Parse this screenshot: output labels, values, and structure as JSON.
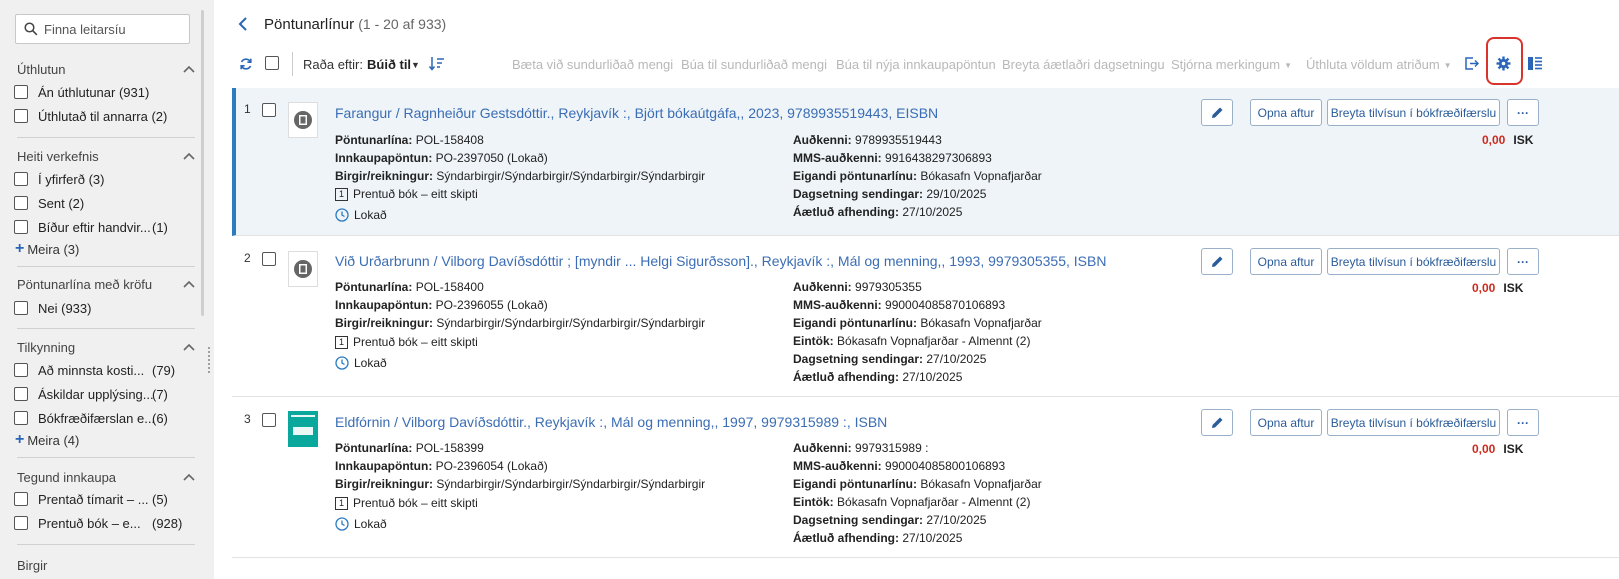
{
  "search": {
    "placeholder": "Finna leitarsíu"
  },
  "facets": [
    {
      "title": "Úthlutun",
      "items": [
        {
          "label": "Án úthlutunar (931)",
          "count": ""
        },
        {
          "label": "Úthlutað til annarra (2)",
          "count": ""
        }
      ]
    },
    {
      "title": "Heiti verkefnis",
      "items": [
        {
          "label": "Í yfirferð (3)",
          "count": ""
        },
        {
          "label": "Sent (2)",
          "count": ""
        },
        {
          "label": "Bíður eftir handvir...",
          "count": "(1)"
        }
      ],
      "more": "Meira (3)"
    },
    {
      "title": "Pöntunarlína með kröfu",
      "items": [
        {
          "label": "Nei (933)",
          "count": ""
        }
      ]
    },
    {
      "title": "Tilkynning",
      "items": [
        {
          "label": "Að minnsta kosti...",
          "count": "(79)"
        },
        {
          "label": "Áskildar upplýsing...",
          "count": "(7)"
        },
        {
          "label": "Bókfræðifærslan e...",
          "count": "(6)"
        }
      ],
      "more": "Meira (4)"
    },
    {
      "title": "Tegund innkaupa",
      "items": [
        {
          "label": "Prentað tímarit – ...",
          "count": "(5)"
        },
        {
          "label": "Prentuð bók – e...",
          "count": "(928)"
        }
      ]
    },
    {
      "title": "Birgir",
      "items": []
    }
  ],
  "header": {
    "title": "Pöntunarlínur",
    "range": "(1 - 20 af 933)"
  },
  "toolbar": {
    "sort_label": "Raða eftir:",
    "sort_value": "Búið til",
    "actions": [
      {
        "label": "Bæta við sundurliðað mengi",
        "dropdown": false
      },
      {
        "label": "Búa til sundurliðað mengi",
        "dropdown": false
      },
      {
        "label": "Búa til nýja innkaupapöntun",
        "dropdown": false
      },
      {
        "label": "Breyta áætlaðri dagsetningu",
        "dropdown": false
      },
      {
        "label": "Stjórna merkingum",
        "dropdown": true
      },
      {
        "label": "Úthluta völdum atriðum",
        "dropdown": true
      }
    ],
    "highlight_color": "#d9342b"
  },
  "row_buttons": {
    "reopen": "Opna aftur",
    "change_ref": "Breyta tilvísun í bókfræðifærslu",
    "more": "···"
  },
  "labels": {
    "pol": "Pöntunarlína:",
    "po": "Innkaupapöntun:",
    "vendor": "Birgir/reikningur:",
    "id": "Auðkenni:",
    "mms": "MMS-auðkenni:",
    "owner": "Eigandi pöntunarlínu:",
    "copies": "Eintök:",
    "sent": "Dagsetning sendingar:",
    "expected": "Áætluð afhending:"
  },
  "rows": [
    {
      "num": "1",
      "title": "Farangur / Ragnheiður Gestsdóttir., Reykjavík :, Björt bókaútgáfa,, 2023, 9789935519443, EISBN",
      "pol": "POL-158408",
      "po": "PO-2397050 (Lokað)",
      "vendor": "Sýndarbirgir/Sýndarbirgir/Sýndarbirgir/Sýndarbirgir",
      "format_num": "1",
      "format": "Prentuð bók – eitt skipti",
      "status": "Lokað",
      "id": "9789935519443",
      "mms": "9916438297306893",
      "owner": "Bókasafn Vopnafjarðar",
      "copies": "",
      "sent": "29/10/2025",
      "expected": "27/10/2025",
      "amount": "0,00",
      "currency": "ISK"
    },
    {
      "num": "2",
      "title": "Við Urðarbrunn / Vilborg Davíðsdóttir ; [myndir ... Helgi Sigurðsson]., Reykjavík :, Mál og menning,, 1993, 9979305355, ISBN",
      "pol": "POL-158400",
      "po": "PO-2396055 (Lokað)",
      "vendor": "Sýndarbirgir/Sýndarbirgir/Sýndarbirgir/Sýndarbirgir",
      "format_num": "1",
      "format": "Prentuð bók – eitt skipti",
      "status": "Lokað",
      "id": "9979305355",
      "mms": "990004085870106893",
      "owner": "Bókasafn Vopnafjarðar",
      "copies": "Bókasafn Vopnafjarðar - Almennt (2)",
      "sent": "27/10/2025",
      "expected": "27/10/2025",
      "amount": "0,00",
      "currency": "ISK"
    },
    {
      "num": "3",
      "title": "Eldfórnin / Vilborg Davíðsdóttir., Reykjavík :, Mál og menning,, 1997, 9979315989 :, ISBN",
      "pol": "POL-158399",
      "po": "PO-2396054 (Lokað)",
      "vendor": "Sýndarbirgir/Sýndarbirgir/Sýndarbirgir/Sýndarbirgir",
      "format_num": "1",
      "format": "Prentuð bók – eitt skipti",
      "status": "Lokað",
      "id": "9979315989 :",
      "mms": "990004085800106893",
      "owner": "Bókasafn Vopnafjarðar",
      "copies": "Bókasafn Vopnafjarðar - Almennt (2)",
      "sent": "27/10/2025",
      "expected": "27/10/2025",
      "amount": "0,00",
      "currency": "ISK"
    }
  ],
  "colors": {
    "link": "#3b6db4",
    "accent": "#2a7bc0",
    "price": "#cc2a1f",
    "sidebar": "#f0f0f0"
  }
}
